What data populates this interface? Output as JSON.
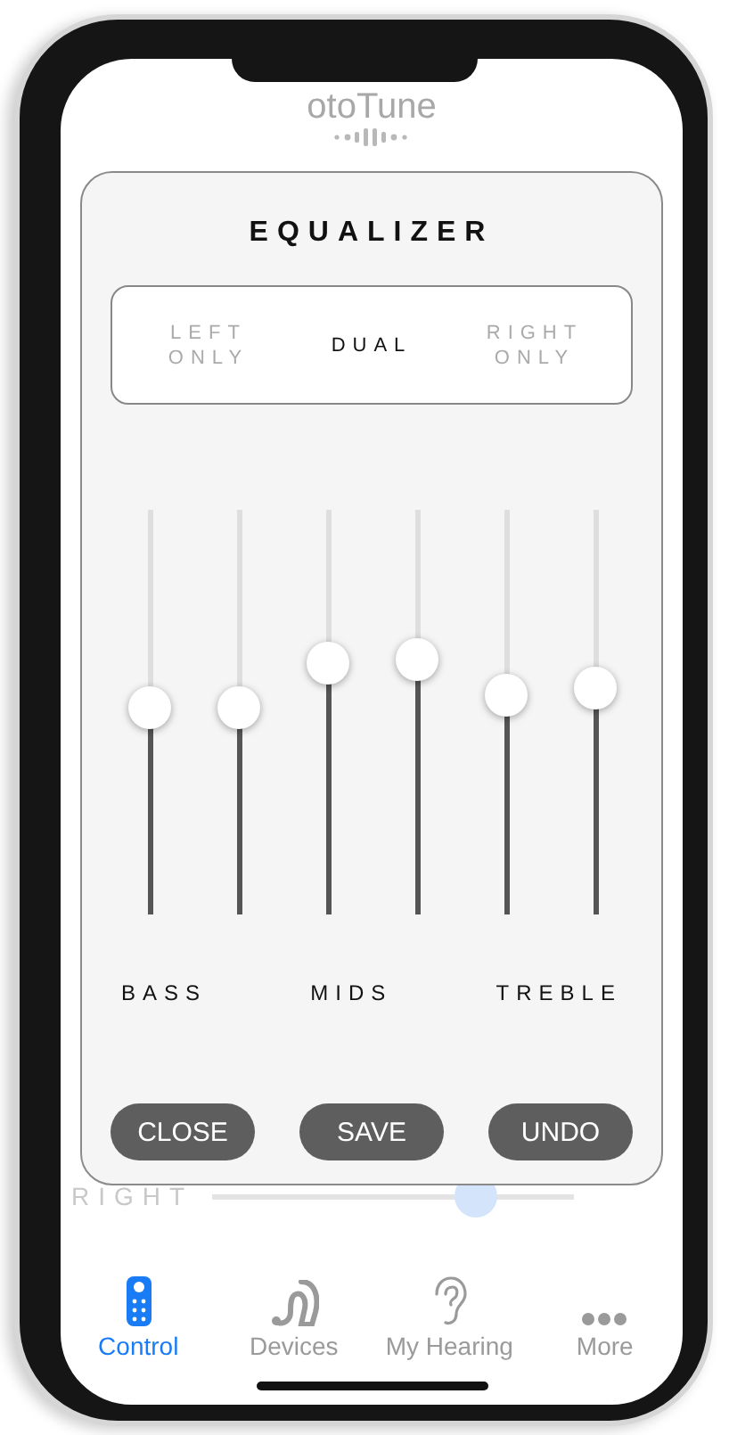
{
  "app": {
    "logo": "otoTune"
  },
  "background": {
    "balance": {
      "label": "RIGHT",
      "level": 0.73
    }
  },
  "equalizer": {
    "title": "EQUALIZER",
    "modes": [
      {
        "label": "LEFT ONLY",
        "selected": false
      },
      {
        "label": "DUAL",
        "selected": true
      },
      {
        "label": "RIGHT ONLY",
        "selected": false
      }
    ],
    "sliders": [
      {
        "level": 0.51
      },
      {
        "level": 0.51
      },
      {
        "level": 0.62
      },
      {
        "level": 0.63
      },
      {
        "level": 0.54
      },
      {
        "level": 0.56
      }
    ],
    "bands": [
      "BASS",
      "MIDS",
      "TREBLE"
    ],
    "buttons": [
      "CLOSE",
      "SAVE",
      "UNDO"
    ]
  },
  "tabs": [
    {
      "label": "Control",
      "kind": "remote",
      "selected": true
    },
    {
      "label": "Devices",
      "kind": "hearing-aid",
      "selected": false
    },
    {
      "label": "My Hearing",
      "kind": "ear",
      "selected": false
    },
    {
      "label": "More",
      "kind": "more",
      "selected": false
    }
  ]
}
